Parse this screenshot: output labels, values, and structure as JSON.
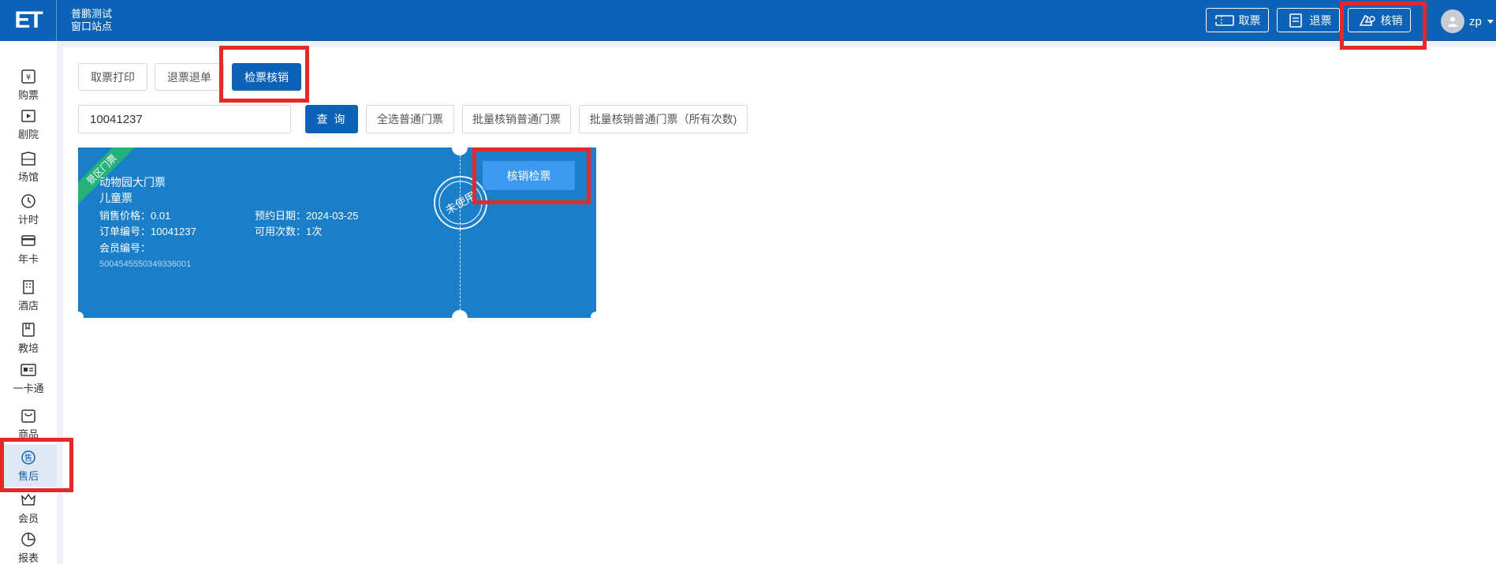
{
  "header": {
    "logo": "ET",
    "org_name": "普鹏测试",
    "site_name": "窗口站点",
    "buttons": [
      {
        "label": "取票",
        "icon": "ticket-icon"
      },
      {
        "label": "退票",
        "icon": "receipt-refund-icon"
      },
      {
        "label": "核销",
        "icon": "verify-stamp-icon"
      }
    ],
    "user_name": "zp"
  },
  "sidebar": {
    "items": [
      {
        "label": "购票",
        "icon": "buy-ticket-icon"
      },
      {
        "label": "剧院",
        "icon": "theater-icon"
      },
      {
        "label": "场馆",
        "icon": "venue-icon"
      },
      {
        "label": "计时",
        "icon": "clock-icon"
      },
      {
        "label": "年卡",
        "icon": "card-icon"
      },
      {
        "label": "酒店",
        "icon": "hotel-icon"
      },
      {
        "label": "教培",
        "icon": "education-icon"
      },
      {
        "label": "一卡通",
        "icon": "id-card-icon"
      },
      {
        "label": "商品",
        "icon": "shopping-bag-icon"
      },
      {
        "label": "售后",
        "icon": "after-sale-icon",
        "active": true
      },
      {
        "label": "会员",
        "icon": "member-icon"
      },
      {
        "label": "报表",
        "icon": "pie-chart-icon"
      }
    ]
  },
  "tabs": [
    {
      "label": "取票打印"
    },
    {
      "label": "退票退单"
    },
    {
      "label": "检票核销",
      "active": true
    }
  ],
  "search": {
    "value": "10041237",
    "query_label": "查 询",
    "select_all_label": "全选普通门票",
    "batch_verify_label": "批量核销普通门票",
    "batch_verify_all_label": "批量核销普通门票（所有次数)"
  },
  "ticket": {
    "ribbon": "景区门票",
    "name": "动物园大门票",
    "type": "儿童票",
    "price_label": "销售价格：0.01",
    "date_label": "预约日期：2024-03-25",
    "order_label": "订单编号：10041237",
    "uses_label": "可用次数：1次",
    "member_label": "会员编号：",
    "code": "5004545550349336001",
    "stamp": "未使用",
    "verify_label": "核销检票"
  },
  "colors": {
    "primary": "#0b62b6",
    "ticket_bg": "#1b7ec8",
    "verify_button": "#3d98f0",
    "ribbon": "#23b27a",
    "highlight": "#e32a27"
  }
}
